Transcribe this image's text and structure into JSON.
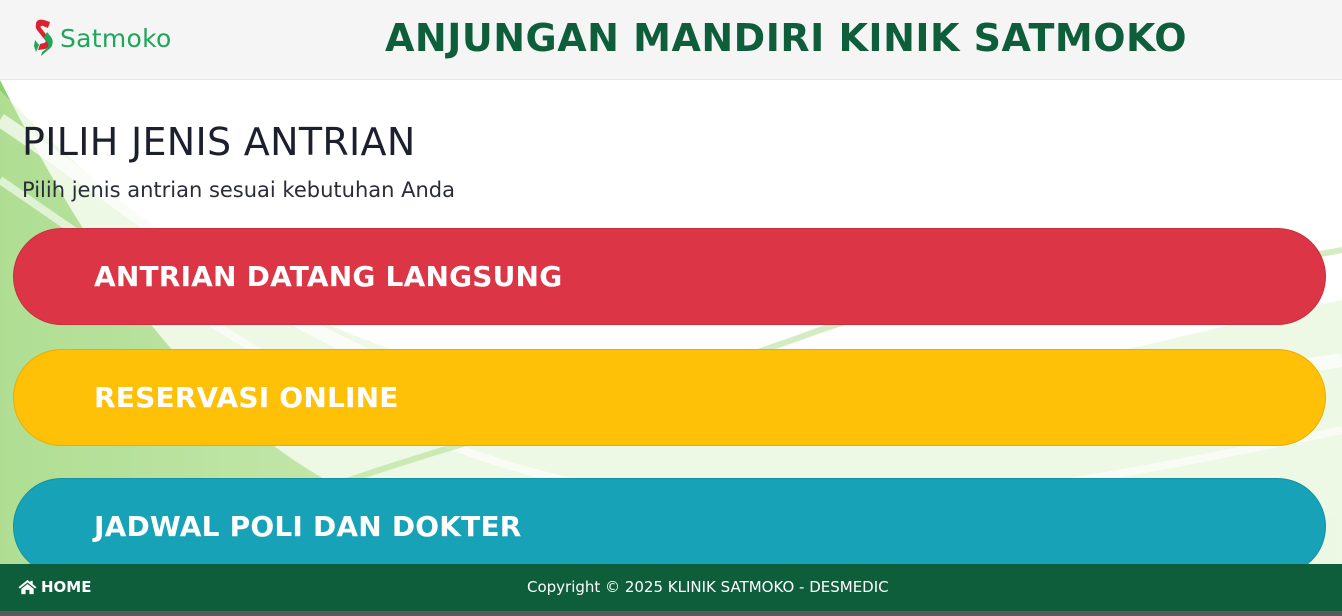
{
  "header": {
    "logo_text": "Satmoko",
    "title": "ANJUNGAN MANDIRI KINIK SATMOKO"
  },
  "main": {
    "title": "PILIH JENIS ANTRIAN",
    "subtitle": "Pilih jenis antrian sesuai kebutuhan Anda",
    "options": [
      {
        "label": "ANTRIAN DATANG LANGSUNG",
        "color": "#dc3545"
      },
      {
        "label": "RESERVASI ONLINE",
        "color": "#ffc107"
      },
      {
        "label": "JADWAL POLI DAN DOKTER",
        "color": "#17a2b8"
      }
    ]
  },
  "footer": {
    "home_label": "HOME",
    "home_icon": "home-icon",
    "copyright": "Copyright © 2025 KLINIK SATMOKO - DESMEDIC"
  },
  "colors": {
    "brand_green": "#0e5e3b",
    "logo_green": "#1ea65a"
  }
}
